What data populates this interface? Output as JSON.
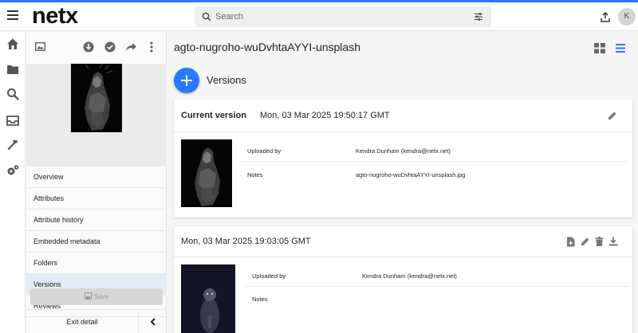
{
  "header": {
    "logo": "netx",
    "search_placeholder": "Search",
    "avatar_initial": "K"
  },
  "detail_nav": {
    "items": [
      {
        "label": "Overview",
        "active": false
      },
      {
        "label": "Attributes",
        "active": false
      },
      {
        "label": "Attribute history",
        "active": false
      },
      {
        "label": "Embedded metadata",
        "active": false
      },
      {
        "label": "Folders",
        "active": false
      },
      {
        "label": "Versions",
        "active": true
      },
      {
        "label": "Reviews",
        "active": false
      }
    ],
    "save_label": "Save",
    "exit_label": "Exit detail"
  },
  "main": {
    "asset_title": "agto-nugroho-wuDvhtaAYYI-unsplash",
    "section_title": "Versions"
  },
  "versions": {
    "current": {
      "label": "Current version",
      "date": "Mon, 03 Mar 2025 19:50:17 GMT",
      "meta": [
        {
          "key": "Uploaded by",
          "value": "Kendra Dunham (kendra@netx.net)"
        },
        {
          "key": "Notes",
          "value": "agto-nugroho-wuDvhtaAYYI-unsplash.jpg"
        }
      ]
    },
    "previous": {
      "date": "Mon, 03 Mar 2025 19:03:05 GMT",
      "meta": [
        {
          "key": "Uploaded by",
          "value": "Kendra Dunham (kendra@netx.net)"
        },
        {
          "key": "Notes",
          "value": ""
        }
      ]
    }
  },
  "colors": {
    "accent": "#2979ff",
    "active_nav": "#e3ecf8"
  }
}
